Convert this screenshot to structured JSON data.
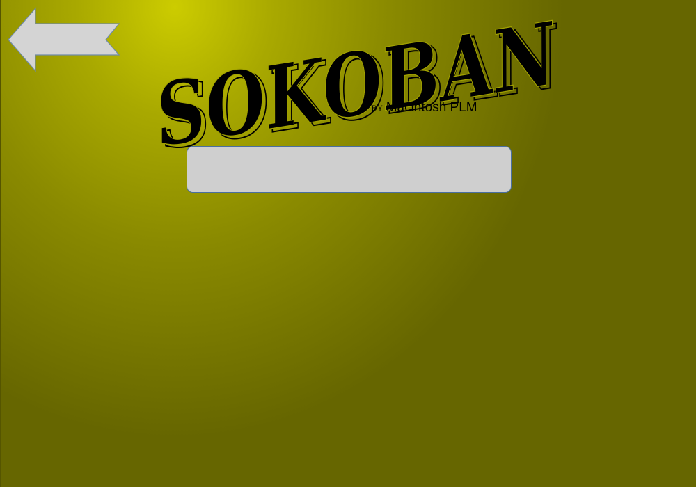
{
  "title": "SOKOBAN",
  "byline": {
    "by": "BY",
    "author": "Macintosh PLM"
  },
  "input": {
    "value": "",
    "placeholder": ""
  },
  "icons": {
    "back": "arrow-left-icon"
  },
  "colors": {
    "background_light": "#cccc00",
    "background_dark": "#666600",
    "arrow_fill": "#d4d4d4",
    "field_fill": "#cfcfcf",
    "field_border": "#4a6fa0"
  }
}
